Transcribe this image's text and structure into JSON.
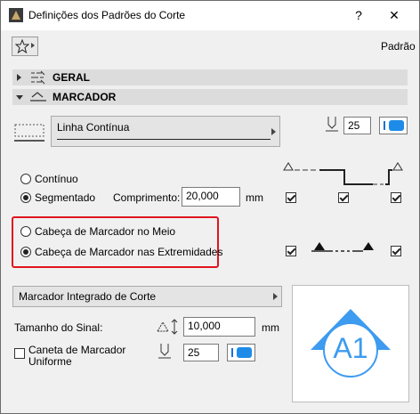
{
  "window": {
    "title": "Definições dos Padrões do Corte",
    "help_label": "?",
    "close_label": "✕"
  },
  "toolbar": {
    "favorites_icon": "star-icon",
    "default_label": "Padrão"
  },
  "sections": {
    "geral": "GERAL",
    "marcador": "MARCADOR"
  },
  "line": {
    "type_value": "Linha Contínua",
    "pen_value": "25"
  },
  "line_style": {
    "continuo_label": "Contínuo",
    "segmentado_label": "Segmentado",
    "selected": "Segmentado",
    "comprimento_label": "Comprimento:",
    "comprimento_value": "20,000",
    "comprimento_unit": "mm",
    "segment_checks": [
      true,
      true,
      true
    ]
  },
  "head_position": {
    "meio_label": "Cabeça de Marcador no Meio",
    "extremidades_label": "Cabeça de Marcador nas Extremidades",
    "selected": "Cabeça de Marcador nas Extremidades",
    "end_checks": [
      true,
      true
    ]
  },
  "integrated": {
    "dropdown_value": "Marcador Integrado de Corte",
    "tamanho_label": "Tamanho do Sinal:",
    "tamanho_value": "10,000",
    "tamanho_unit": "mm",
    "caneta_label_1": "Caneta de Marcador",
    "caneta_label_2": "Uniforme",
    "caneta_checked": false,
    "caneta_value": "25"
  },
  "preview": {
    "label": "A1",
    "color": "#3d9bf0"
  },
  "colors": {
    "highlight": "#e0141e",
    "accent": "#1e8be8"
  }
}
